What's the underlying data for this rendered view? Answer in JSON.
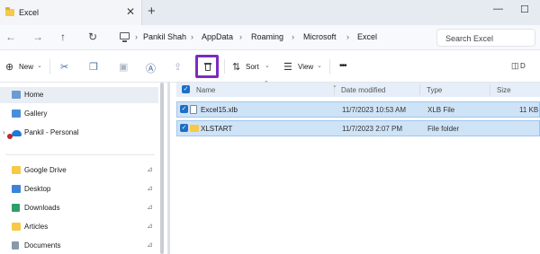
{
  "window": {
    "tab_title": "Excel",
    "close_tab": "✕",
    "new_tab": "+",
    "minimize": "—",
    "maximize": "☐"
  },
  "navigation": {
    "back": "←",
    "forward": "→",
    "up": "↑",
    "refresh": "↻",
    "breadcrumb": [
      "Pankil Shah",
      "AppData",
      "Roaming",
      "Microsoft",
      "Excel"
    ],
    "separator": "›",
    "search_placeholder": "Search Excel"
  },
  "toolbar": {
    "new_label": "New",
    "sort_label": "Sort",
    "view_label": "View",
    "more_label": "•••",
    "details_label": "D"
  },
  "sidebar": {
    "items": [
      {
        "label": "Home",
        "icon": "home-icon"
      },
      {
        "label": "Gallery",
        "icon": "gallery-icon"
      },
      {
        "label": "Pankil - Personal",
        "icon": "onedrive-icon"
      },
      {
        "label": "Google Drive",
        "icon": "folder-icon"
      },
      {
        "label": "Desktop",
        "icon": "desktop-icon"
      },
      {
        "label": "Downloads",
        "icon": "downloads-icon"
      },
      {
        "label": "Articles",
        "icon": "folder-icon"
      },
      {
        "label": "Documents",
        "icon": "documents-icon"
      }
    ],
    "pin_glyph": "📌"
  },
  "file_list": {
    "columns": [
      "Name",
      "Date modified",
      "Type",
      "Size"
    ],
    "rows": [
      {
        "name": "Excel15.xlb",
        "date": "11/7/2023 10:53 AM",
        "type": "XLB File",
        "size": "11 KB",
        "icon": "document-icon"
      },
      {
        "name": "XLSTART",
        "date": "11/7/2023 2:07 PM",
        "type": "File folder",
        "size": "",
        "icon": "folder-icon"
      }
    ],
    "check_glyph": "✓"
  },
  "colors": {
    "accent": "#1f6ec5",
    "selection": "#cfe3f7",
    "highlight_box": "#7b2cbf"
  }
}
